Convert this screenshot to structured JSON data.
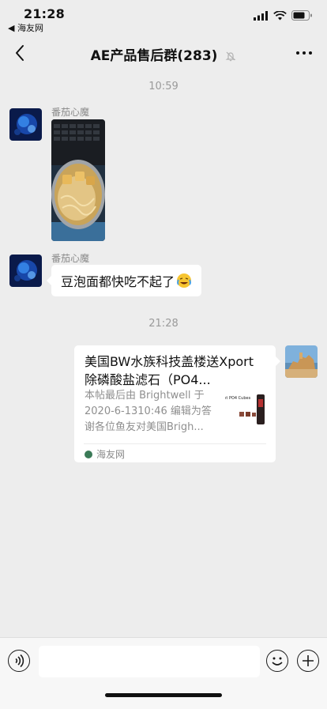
{
  "status": {
    "time": "21:28",
    "back_app": "◀ 海友网"
  },
  "header": {
    "title": "AE产品售后群(283)",
    "back_icon": "chevron-left-icon",
    "more_icon": "more-horizontal-icon"
  },
  "messages": {
    "ts1": "10:59",
    "m1_sender": "番茄心魔",
    "m2_sender": "番茄心魔",
    "m2_text": "豆泡面都快吃不起了",
    "m2_emoji": "crying-laughing-emoji",
    "ts2": "21:28",
    "card": {
      "title": "美国BW水族科技盖楼送Xport除磷酸盐滤石（PO4...",
      "desc": "本帖最后由 Brightwell 于 2020-6-1310:46 编辑为答谢各位鱼友对美国Brigh...",
      "source": "海友网",
      "thumb_text": "ıt PO4 Cubes"
    }
  },
  "input": {
    "value": "",
    "voice_icon": "voice-icon",
    "emoji_icon": "emoji-icon",
    "plus_icon": "plus-icon"
  },
  "colors": {
    "background": "#ededed",
    "bubble": "#ffffff",
    "timestamp": "#9a9a9a"
  }
}
